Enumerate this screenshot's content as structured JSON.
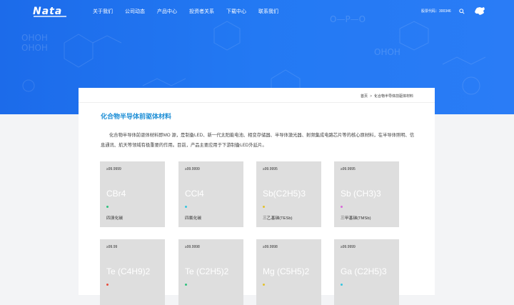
{
  "header": {
    "logo_text": "Nata",
    "nav": [
      "关于我们",
      "公司动态",
      "产品中心",
      "投资者关系",
      "下载中心",
      "联系我们"
    ],
    "stock_code": "股票代码：300346"
  },
  "hero": {
    "chem": [
      "OHOH",
      "OHOH",
      "O—P—O",
      "OHOH"
    ]
  },
  "breadcrumb": {
    "home": "首页",
    "separator": ">",
    "current": "化合物半导体前驱体材料"
  },
  "page": {
    "title": "化合物半导体前驱体材料",
    "description": "化合物半导体前驱体材料即MO 源，是制备LED、新一代太阳能电池、相变存储器、半导体激光器、射频集成电路芯片等的核心原材料，在半导体照明、信息通讯、航天等领域有极重要的作用。目前，产品主要应用于下游制备LED外延片。"
  },
  "colors": {
    "accent": "#1f8fd6",
    "hero": "#2379f3"
  },
  "products": [
    {
      "purity": "≥99.9999",
      "formula": "CBr4",
      "name": "四溴化碳",
      "dot": "#2ec27e"
    },
    {
      "purity": "≥99.9999",
      "formula": "CCl4",
      "name": "四氯化碳",
      "dot": "#35c6e0"
    },
    {
      "purity": "≥99.9995",
      "formula": "Sb(C2H5)3",
      "name": "三乙基锑(TESb)",
      "dot": "#e3c22c"
    },
    {
      "purity": "≥99.9995",
      "formula": "Sb (CH3)3",
      "name": "三甲基锑(TMSb)",
      "dot": "#d86ad8"
    },
    {
      "purity": "≥99.99",
      "formula": "Te (C4H9)2",
      "name": "",
      "dot": "#e84d3d"
    },
    {
      "purity": "≥99.9998",
      "formula": "Te (C2H5)2",
      "name": "",
      "dot": "#2ec27e"
    },
    {
      "purity": "≥99.9998",
      "formula": "Mg (C5H5)2",
      "name": "",
      "dot": "#e3c22c"
    },
    {
      "purity": "≥99.9999",
      "formula": "Ga (C2H5)3",
      "name": "",
      "dot": "#35c6e0"
    }
  ]
}
